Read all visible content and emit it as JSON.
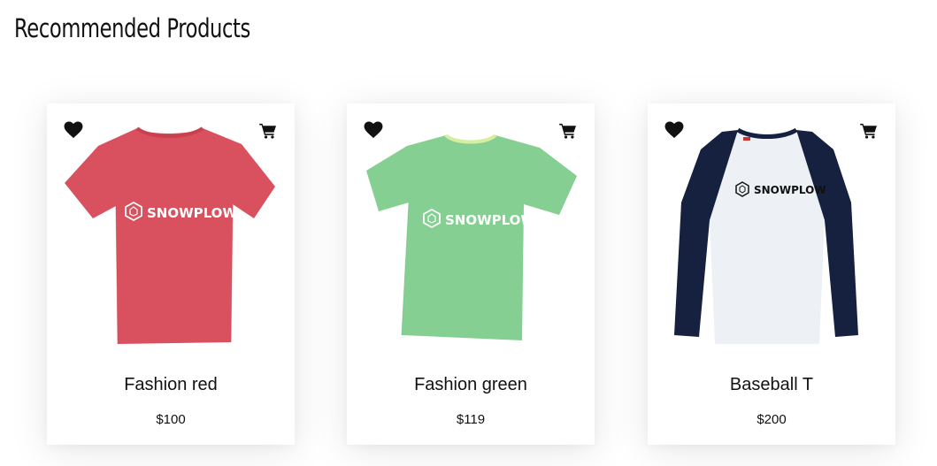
{
  "page": {
    "title": "Recommended Products"
  },
  "products": [
    {
      "name": "Fashion red",
      "price": "$100",
      "image": {
        "kind": "tshirt",
        "color": "#d9505f",
        "collar": "#c9404f",
        "brand": "SNOWPLOW",
        "brand_color": "#ffffff"
      }
    },
    {
      "name": "Fashion green",
      "price": "$119",
      "image": {
        "kind": "tshirt",
        "color": "#85cf92",
        "collar": "#d5eea0",
        "brand": "SNOWPLOW",
        "brand_color": "#ffffff"
      }
    },
    {
      "name": "Baseball T",
      "price": "$200",
      "image": {
        "kind": "raglan",
        "color": "#edf0f4",
        "sleeve_color": "#16213f",
        "brand": "SNOWPLOW",
        "brand_color": "#111111"
      }
    }
  ],
  "icons": {
    "favorite": "heart-icon",
    "cart": "shopping-cart-icon",
    "icon_color": "#111111"
  }
}
